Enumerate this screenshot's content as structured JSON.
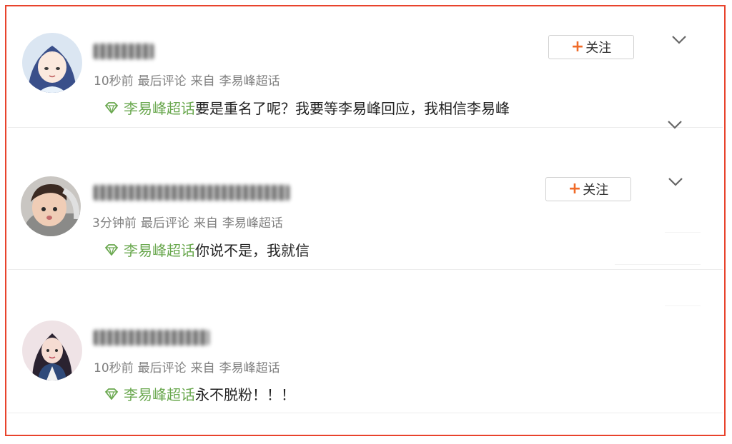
{
  "posts": [
    {
      "time": "10秒前",
      "activity": "最后评论",
      "from_label": "来自",
      "source": "李易峰超话",
      "topic_link": "李易峰超话",
      "comment": "要是重名了呢？我要等李易峰回应，我相信李易峰",
      "follow_plus": "+",
      "follow_label": "关注"
    },
    {
      "time": "3分钟前",
      "activity": "最后评论",
      "from_label": "来自",
      "source": "李易峰超话",
      "topic_link": "李易峰超话",
      "comment": "你说不是，我就信",
      "follow_plus": "+",
      "follow_label": "关注"
    },
    {
      "time": "10秒前",
      "activity": "最后评论",
      "from_label": "来自",
      "source": "李易峰超话",
      "topic_link": "李易峰超话",
      "comment": "永不脱粉！！！"
    }
  ],
  "colors": {
    "frame": "#e8432c",
    "topic_green": "#6aa84f",
    "follow_plus": "#f06b28"
  },
  "icons": [
    "chevron-down-icon",
    "super-topic-diamond-icon"
  ]
}
